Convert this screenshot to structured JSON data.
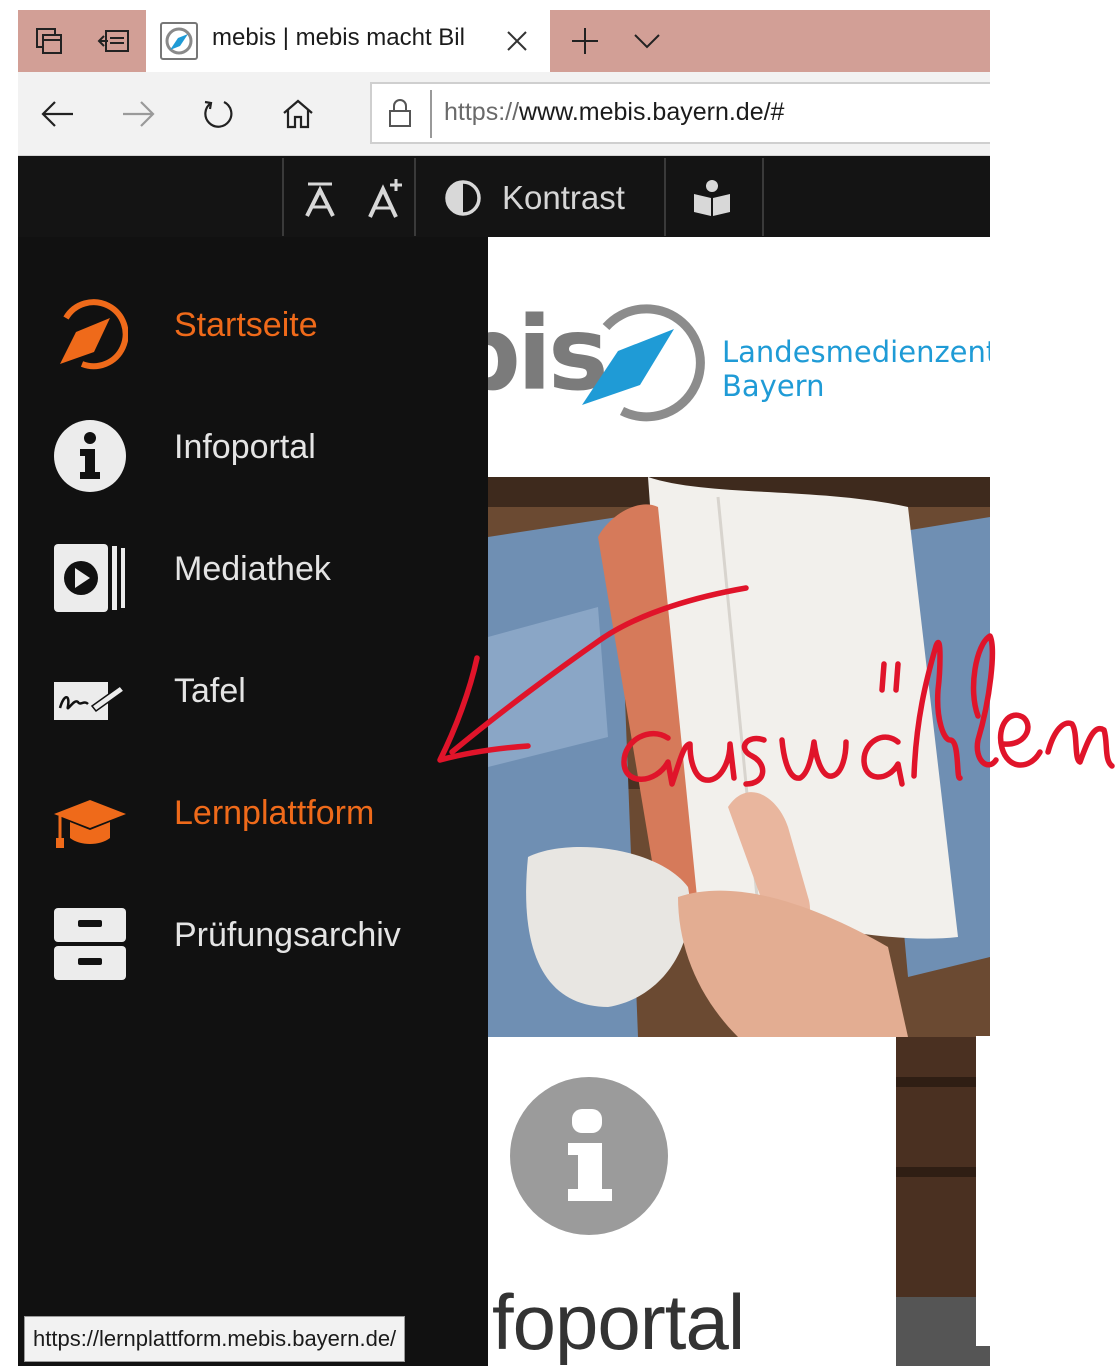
{
  "browser": {
    "tab_title": "mebis | mebis macht Bil",
    "url_prefix": "https://",
    "url_host": "www.mebis.bayern.de/#",
    "icons": {
      "tab_actions": "tab-stack-icon",
      "set_aside": "set-aside-icon",
      "new_tab": "plus-icon",
      "tab_list": "chevron-down-icon",
      "back": "arrow-left-icon",
      "forward": "arrow-right-icon",
      "refresh": "refresh-icon",
      "home": "home-icon",
      "secure": "lock-icon"
    }
  },
  "accessibility": {
    "kontrast_label": "Kontrast"
  },
  "sidebar": {
    "items": [
      {
        "label": "Startseite",
        "icon": "compass-icon",
        "active": true
      },
      {
        "label": "Infoportal",
        "icon": "info-icon",
        "active": false
      },
      {
        "label": "Mediathek",
        "icon": "play-icon",
        "active": false
      },
      {
        "label": "Tafel",
        "icon": "whiteboard-pen-icon",
        "active": false
      },
      {
        "label": "Lernplattform",
        "icon": "graduation-cap-icon",
        "active": true
      },
      {
        "label": "Prüfungsarchiv",
        "icon": "archive-drawer-icon",
        "active": false
      }
    ]
  },
  "brand": {
    "logo_fragment": "bis",
    "line1": "Landesmedienzentr",
    "line2": "Bayern"
  },
  "card": {
    "title": "foportal"
  },
  "status_url": "https://lernplattform.mebis.bayern.de/",
  "annotation": {
    "text": "auswählen",
    "color": "#e0142a"
  },
  "colors": {
    "accent": "#ef6a1a",
    "brand_blue": "#1f9bd6",
    "tabbar": "#d29f96",
    "site_bg": "#111111"
  }
}
